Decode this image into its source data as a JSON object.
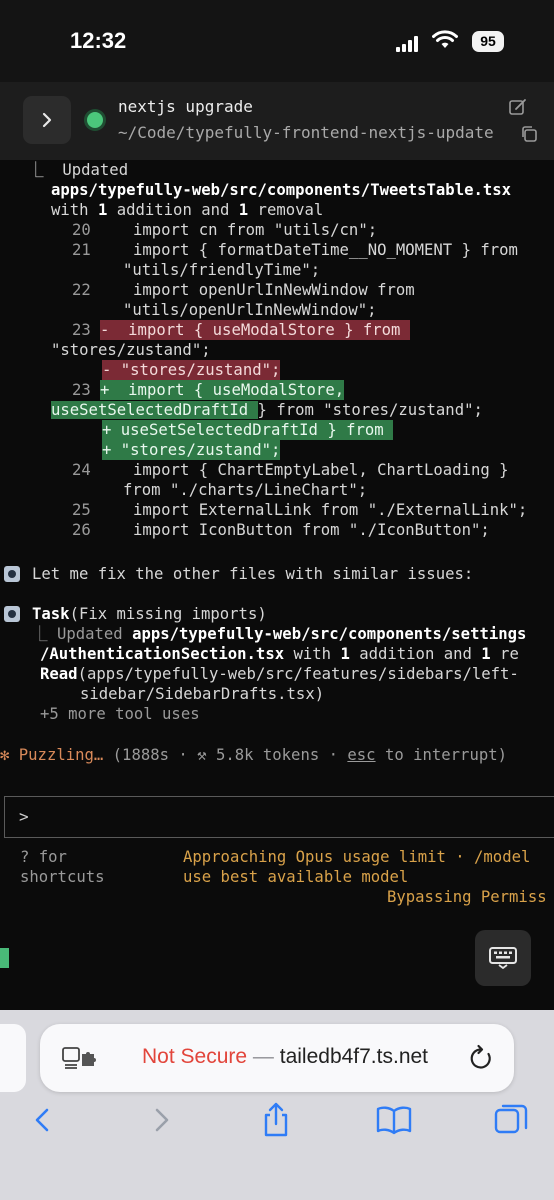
{
  "status_bar": {
    "time": "12:32",
    "battery": "95"
  },
  "session": {
    "title": "nextjs upgrade",
    "path": "~/Code/typefully-frontend-nextjs-update"
  },
  "terminal": {
    "updated_prefix": "⎿  Updated",
    "file_path": "apps/typefully-web/src/components/TweetsTable.tsx",
    "summary": {
      "with": "with ",
      "additions": "1",
      "addition_text": " addition and ",
      "removals": "1",
      "removal_text": " removal"
    },
    "diff": [
      {
        "n": "20",
        "sign": " ",
        "text": "import cn from \"utils/cn\";"
      },
      {
        "n": "21",
        "sign": " ",
        "text": "import { formatDateTime__NO_MOMENT } from",
        "cont": "\"utils/friendlyTime\";"
      },
      {
        "n": "22",
        "sign": " ",
        "text": "import openUrlInNewWindow from",
        "cont": "\"utils/openUrlInNewWindow\";"
      }
    ],
    "removed": {
      "n": "23",
      "sign": "-",
      "text": " import { useModalStore } from ",
      "wrap": "\"stores/zustand\";",
      "extra": "- \"stores/zustand\";"
    },
    "added": {
      "n": "23",
      "sign": "+",
      "text": " import { useModalStore,",
      "wrap_hl": "useSetSelectedDraftId ",
      "wrap_rest": "} from \"stores/zustand\";",
      "extra1": "+ useSetSelectedDraftId } from ",
      "extra2": "+ \"stores/zustand\";"
    },
    "diff_tail": [
      {
        "n": "24",
        "text": "import { ChartEmptyLabel, ChartLoading }",
        "cont": "from \"./charts/LineChart\";"
      },
      {
        "n": "25",
        "text": "import ExternalLink from \"./ExternalLink\";"
      },
      {
        "n": "26",
        "text": "import IconButton from \"./IconButton\";"
      }
    ],
    "message": "Let me fix the other files with similar issues:",
    "task": {
      "name": "Task",
      "desc": "(Fix missing imports)",
      "updated_prefix": "⎿ Updated ",
      "updated_path1": "apps/typefully-web/src/components/settings",
      "updated_path2": "/AuthenticationSection.tsx",
      "updated_with": " with ",
      "updated_add": "1",
      "updated_rest": " addition and ",
      "updated_rem": "1",
      "updated_tail": " re",
      "read_label": "Read",
      "read_arg1": "(apps/typefully-web/src/features/sidebars/left-",
      "read_arg2": "sidebar/SidebarDrafts.tsx)",
      "more": "+5 more tool uses"
    },
    "spinner": {
      "glyph": "✻",
      "word": "Puzzling…",
      "meta_open": " (1888s · ",
      "tool_glyph": "⚒",
      "tokens": " 5.8k tokens · ",
      "esc": "esc",
      "meta_close": " to interrupt)"
    },
    "prompt_caret": ">",
    "hint_line1": "? for",
    "hint_line2": "shortcuts",
    "warning1": "Approaching Opus usage limit · /model",
    "warning2": "use best available model",
    "permissions": "Bypassing Permiss"
  },
  "browser": {
    "not_secure": "Not Secure",
    "separator": " — ",
    "host": "tailedb4f7.ts.net"
  },
  "colors": {
    "added_bg": "#2f7a47",
    "removed_bg": "#7b2a35",
    "accent_orange": "#d98a5a",
    "status_green": "#4bc77b",
    "not_secure": "#e2453b",
    "ios_blue": "#2f7cf6"
  }
}
